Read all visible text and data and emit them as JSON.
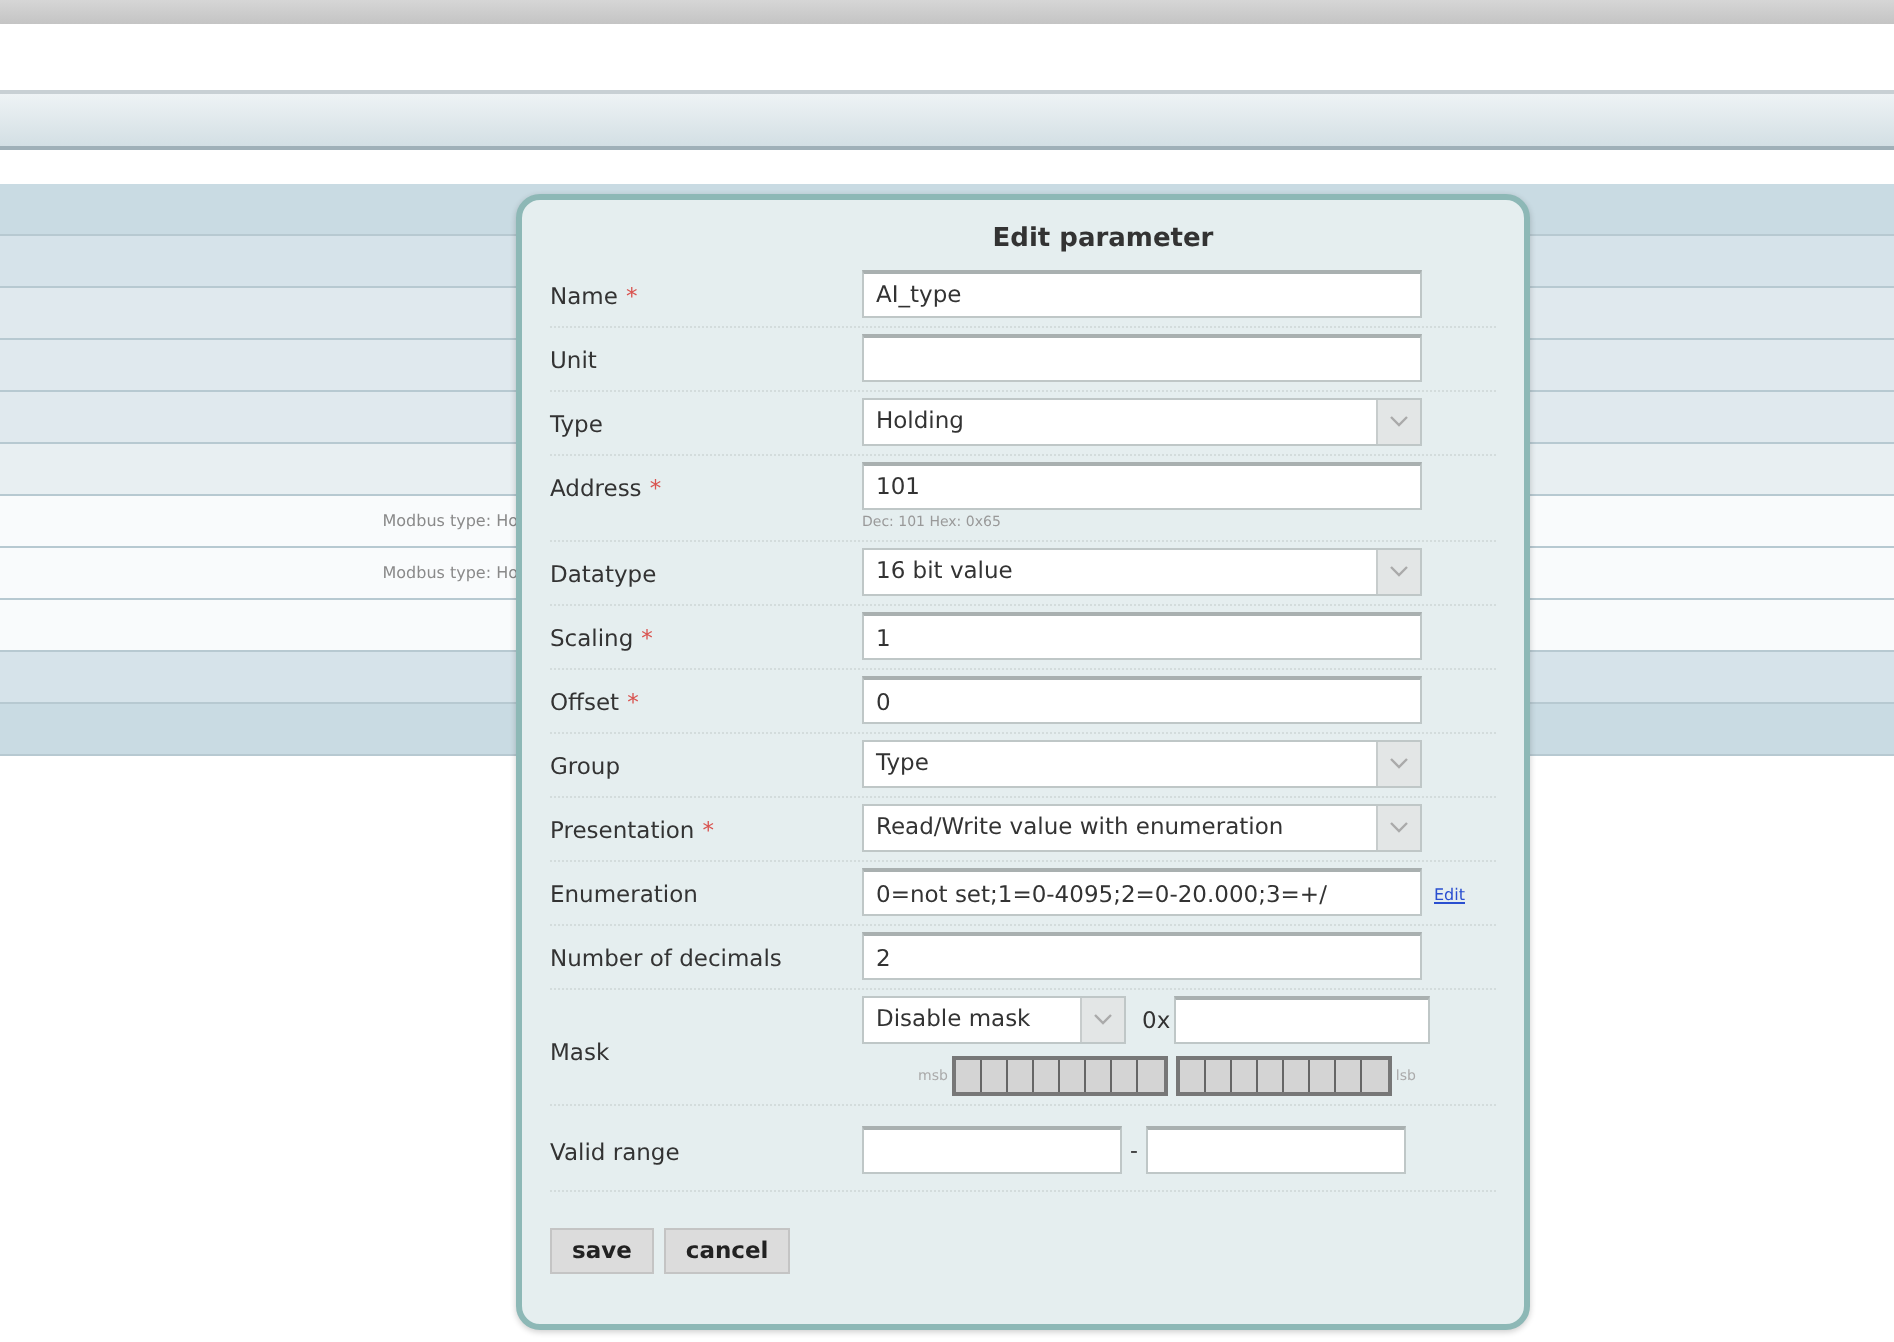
{
  "table_rows": [
    {
      "column_1": "Modbus type: Ho"
    },
    {
      "column_1": "Modbus type: Ho"
    }
  ],
  "dialog": {
    "title": "Edit parameter",
    "fields": [
      {
        "kind": "text",
        "label": "Name",
        "required_mark": "*",
        "value": "AI_type"
      },
      {
        "kind": "text",
        "label": "Unit"
      },
      {
        "kind": "select",
        "label": "Type",
        "value": "Holding"
      },
      {
        "kind": "text",
        "label": "Address",
        "required_mark": "*",
        "value": "101",
        "hint": "Dec: 101   Hex: 0x65"
      },
      {
        "kind": "select",
        "label": "Datatype",
        "value": "16 bit value"
      },
      {
        "kind": "text",
        "label": "Scaling",
        "required_mark": "*",
        "value": "1"
      },
      {
        "kind": "text",
        "label": "Offset",
        "required_mark": "*",
        "value": "0"
      },
      {
        "kind": "select",
        "label": "Group",
        "value": "Type"
      },
      {
        "kind": "select",
        "label": "Presentation",
        "required_mark": "*",
        "value": "Read/Write value with enumeration"
      },
      {
        "kind": "enum",
        "label": "Enumeration",
        "value": "0=not set;1=0-4095;2=0-20.000;3=+/",
        "link": "Edit"
      },
      {
        "kind": "text",
        "label": "Number of decimals",
        "value": "2"
      },
      {
        "kind": "mask",
        "label": "Mask",
        "value": "Disable mask",
        "prefix": "0x",
        "msb": "msb",
        "lsb": "lsb"
      },
      {
        "kind": "range",
        "label": "Valid range",
        "separator": "-"
      }
    ],
    "buttons": [
      "save",
      "cancel"
    ]
  }
}
